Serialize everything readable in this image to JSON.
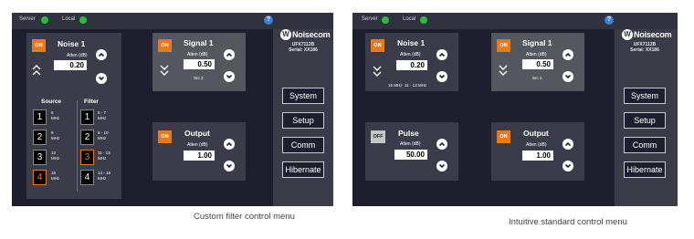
{
  "status": {
    "server_label": "Server",
    "local_label": "Local",
    "help_icon": "?"
  },
  "brand": {
    "logo_text": "Noisecom",
    "model_lines": [
      "UFX7112B",
      "Serial: XX186"
    ]
  },
  "side_buttons": [
    "System",
    "Setup",
    "Comm",
    "Hibernate"
  ],
  "left": {
    "noise": {
      "state": "ON",
      "title": "Noise 1",
      "atten_label": "Atten (dB)",
      "value": "0.20"
    },
    "signal": {
      "state": "ON",
      "title": "Signal 1",
      "atten_label": "Atten (dB)",
      "value": "0.50",
      "src": "Src 2"
    },
    "output": {
      "state": "ON",
      "title": "Output",
      "atten_label": "Atten (dB)",
      "value": "1.00"
    },
    "source_header": "Source",
    "filter_header": "Filter",
    "source_rows": [
      {
        "num": "1",
        "label": "6\nMHz"
      },
      {
        "num": "2",
        "label": "9\nMHz"
      },
      {
        "num": "3",
        "label": "12\nMHz"
      },
      {
        "num": "4",
        "label": "15\nMHz"
      }
    ],
    "filter_rows": [
      {
        "num": "1",
        "label": "5 - 7\nMHz"
      },
      {
        "num": "2",
        "label": "8 - 10\nMHz"
      },
      {
        "num": "3",
        "label": "11 - 13\nMHz"
      },
      {
        "num": "4",
        "label": "14 - 16\nMHz"
      }
    ],
    "caption": "Custom filter control menu"
  },
  "right": {
    "noise": {
      "state": "ON",
      "title": "Noise 1",
      "atten_label": "Atten (dB)",
      "value": "0.20",
      "info": "15 MHz  11 - 13 MHz"
    },
    "signal": {
      "state": "ON",
      "title": "Signal 1",
      "atten_label": "Atten (dB)",
      "value": "0.50",
      "src": "Src 2"
    },
    "pulse": {
      "state": "OFF",
      "title": "Pulse",
      "atten_label": "Atten (dB)",
      "value": "50.00"
    },
    "output": {
      "state": "ON",
      "title": "Output",
      "atten_label": "Atten (dB)",
      "value": "1.00"
    },
    "caption": "Intuitive standard control menu"
  },
  "colors": {
    "accent": "#e87a1e",
    "status_ok": "#2fb846",
    "help": "#3b80d6"
  }
}
